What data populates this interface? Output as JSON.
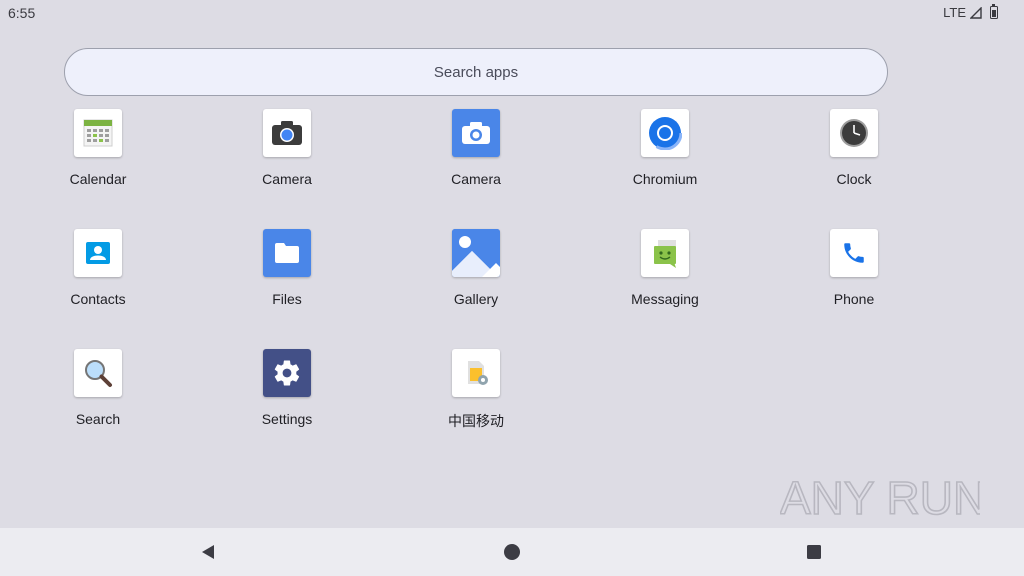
{
  "status_bar": {
    "time": "6:55",
    "network": "LTE"
  },
  "search": {
    "placeholder": "Search apps"
  },
  "apps": [
    {
      "label": "Calendar",
      "icon": "calendar-icon"
    },
    {
      "label": "Camera",
      "icon": "camera-icon"
    },
    {
      "label": "Camera",
      "icon": "camera-blue-icon"
    },
    {
      "label": "Chromium",
      "icon": "chromium-icon"
    },
    {
      "label": "Clock",
      "icon": "clock-icon"
    },
    {
      "label": "Contacts",
      "icon": "contacts-icon"
    },
    {
      "label": "Files",
      "icon": "folder-icon"
    },
    {
      "label": "Gallery",
      "icon": "gallery-icon"
    },
    {
      "label": "Messaging",
      "icon": "messaging-icon"
    },
    {
      "label": "Phone",
      "icon": "phone-icon"
    },
    {
      "label": "Search",
      "icon": "magnifier-icon"
    },
    {
      "label": "Settings",
      "icon": "gear-icon"
    },
    {
      "label": "中国移动",
      "icon": "sim-toolkit-icon"
    }
  ],
  "navigation": {
    "back": "back-icon",
    "home": "home-icon",
    "recents": "recents-icon"
  },
  "watermark": {
    "text": "ANY RUN"
  },
  "colors": {
    "background": "#dddce4",
    "search_bg": "#eef0fb",
    "nav_bar": "#ececf1",
    "settings_tile": "#435087",
    "files_tile": "#4a86e8",
    "phone_blue": "#1a73e8"
  }
}
